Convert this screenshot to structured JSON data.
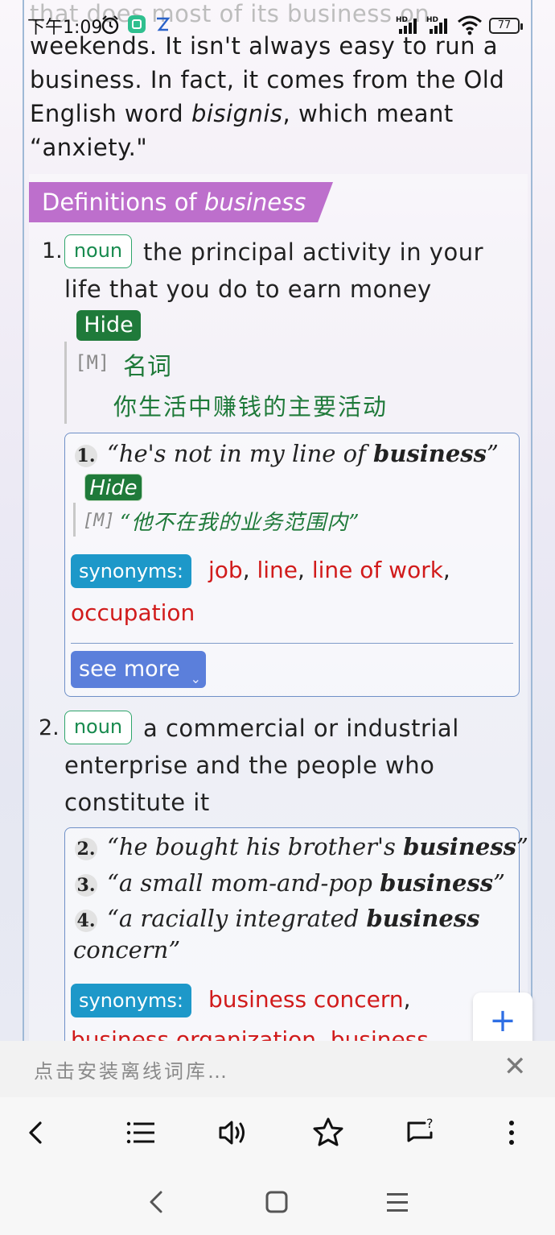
{
  "status_bar": {
    "time": "下午1:09",
    "battery": "77"
  },
  "intro": {
    "line0": "that does most of its business on",
    "line1": "weekends. It isn't always easy to run a",
    "line2": "business. In fact, it comes from the Old",
    "line3_a": "English word ",
    "line3_em": "bisignis",
    "line3_b": ", which meant",
    "line4": "“anxiety.\""
  },
  "definitions": {
    "header_prefix": "Definitions of ",
    "header_word": "business",
    "def1": {
      "number": "1.",
      "pos": "noun",
      "gloss_line1": "the principal activity in your",
      "gloss_line2": "life that you do to earn money",
      "hide": "Hide",
      "m_tag": "[M]",
      "cn_pos": "名词",
      "cn_gloss": "你生活中赚钱的主要活动",
      "example": {
        "number": "1.",
        "open_quote": "“he's not in my line of ",
        "bold": "business",
        "close_quote": "”",
        "hide": "Hide",
        "m_tag": "[M]",
        "cn": "“他不在我的业务范围内”"
      },
      "synonyms_label": "synonyms:",
      "synonyms": [
        "job",
        "line",
        "line of work",
        "occupation"
      ],
      "see_more": "see more"
    },
    "def2": {
      "number": "2.",
      "pos": "noun",
      "gloss_line1": "a commercial or industrial",
      "gloss_line2": "enterprise and the people who",
      "gloss_line3": "constitute it",
      "examples": [
        {
          "number": "2.",
          "pre": "“he bought his brother's ",
          "bold": "business",
          "post": "”"
        },
        {
          "number": "3.",
          "pre": "“a small mom-and-pop ",
          "bold": "business",
          "post": "”"
        },
        {
          "number": "4.",
          "pre": "“a racially integrated ",
          "bold": "business",
          "post": "",
          "cont": "concern”"
        }
      ],
      "synonyms_label": "synonyms:",
      "synonyms": [
        "business concern",
        "business organization",
        "business"
      ]
    }
  },
  "fab": {
    "label": "+"
  },
  "offline_bar": {
    "text": "点击安装离线词库…",
    "close": "✕"
  },
  "toolbar": {
    "items": [
      "back-icon",
      "list-icon",
      "speaker-icon",
      "star-icon",
      "feedback-icon",
      "more-icon"
    ]
  },
  "navbar": {
    "items": [
      "nav-back-icon",
      "home-icon",
      "recents-icon"
    ]
  }
}
